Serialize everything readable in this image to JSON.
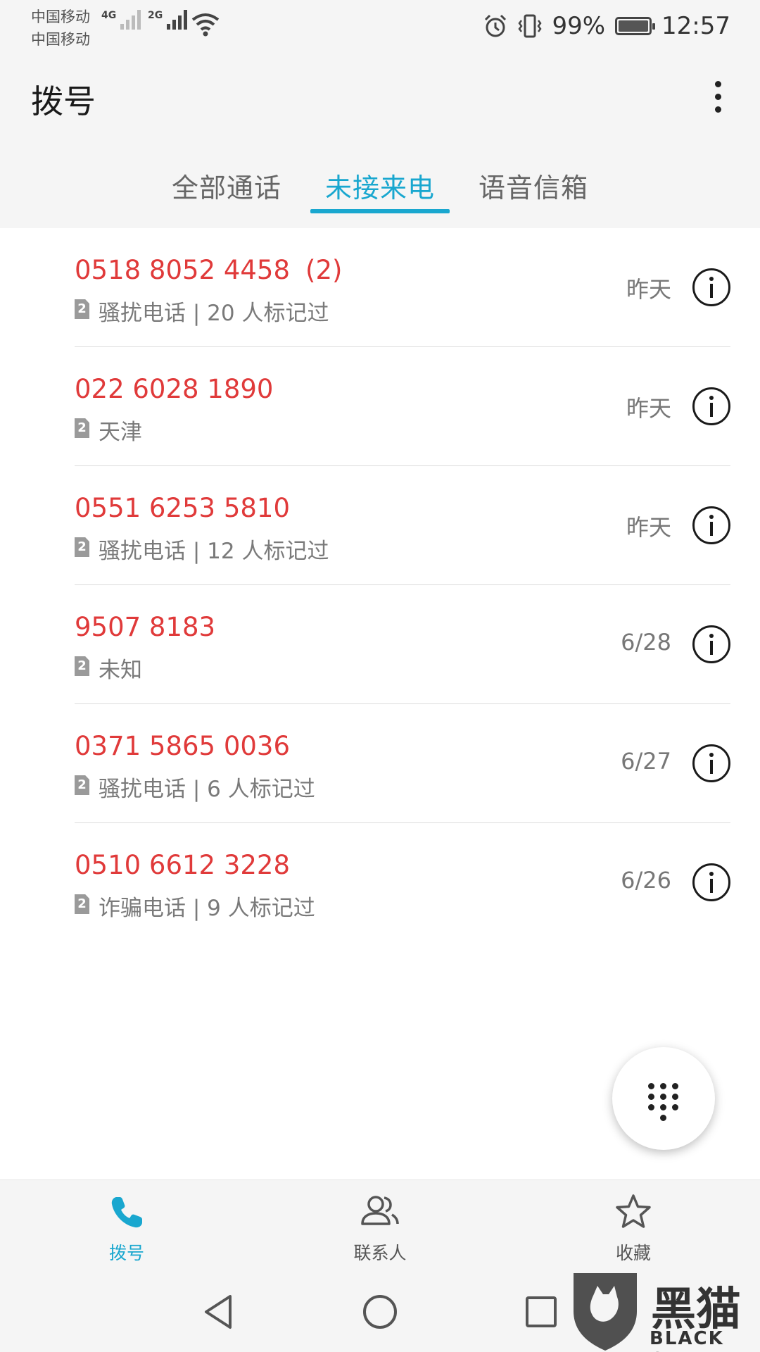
{
  "status_bar": {
    "carrier_1": "中国移动",
    "carrier_2": "中国移动",
    "network_1": "4G",
    "network_2": "2G",
    "battery_percent": "99%",
    "battery_level": 0.99,
    "time": "12:57"
  },
  "app_bar": {
    "title": "拨号"
  },
  "tabs": [
    {
      "label": "全部通话",
      "active": false
    },
    {
      "label": "未接来电",
      "active": true
    },
    {
      "label": "语音信箱",
      "active": false
    }
  ],
  "calls": [
    {
      "number": "0518 8052 4458",
      "count": "(2)",
      "sim": "2",
      "description": "骚扰电话 | 20 人标记过",
      "date": "昨天"
    },
    {
      "number": "022 6028 1890",
      "count": "",
      "sim": "2",
      "description": "天津",
      "date": "昨天"
    },
    {
      "number": "0551 6253 5810",
      "count": "",
      "sim": "2",
      "description": "骚扰电话 | 12 人标记过",
      "date": "昨天"
    },
    {
      "number": "9507 8183",
      "count": "",
      "sim": "2",
      "description": "未知",
      "date": "6/28"
    },
    {
      "number": "0371 5865 0036",
      "count": "",
      "sim": "2",
      "description": "骚扰电话 | 6 人标记过",
      "date": "6/27"
    },
    {
      "number": "0510 6612 3228",
      "count": "",
      "sim": "2",
      "description": "诈骗电话 | 9 人标记过",
      "date": "6/26"
    }
  ],
  "bottom_nav": [
    {
      "label": "拨号",
      "icon": "phone-icon",
      "active": true
    },
    {
      "label": "联系人",
      "icon": "contacts-icon",
      "active": false
    },
    {
      "label": "收藏",
      "icon": "star-icon",
      "active": false
    }
  ],
  "watermark": {
    "text": "黑猫",
    "sub": "BLACK CAT"
  },
  "colors": {
    "accent": "#19a7cf",
    "missed_call": "#e03a3a",
    "background": "#f5f5f5"
  }
}
